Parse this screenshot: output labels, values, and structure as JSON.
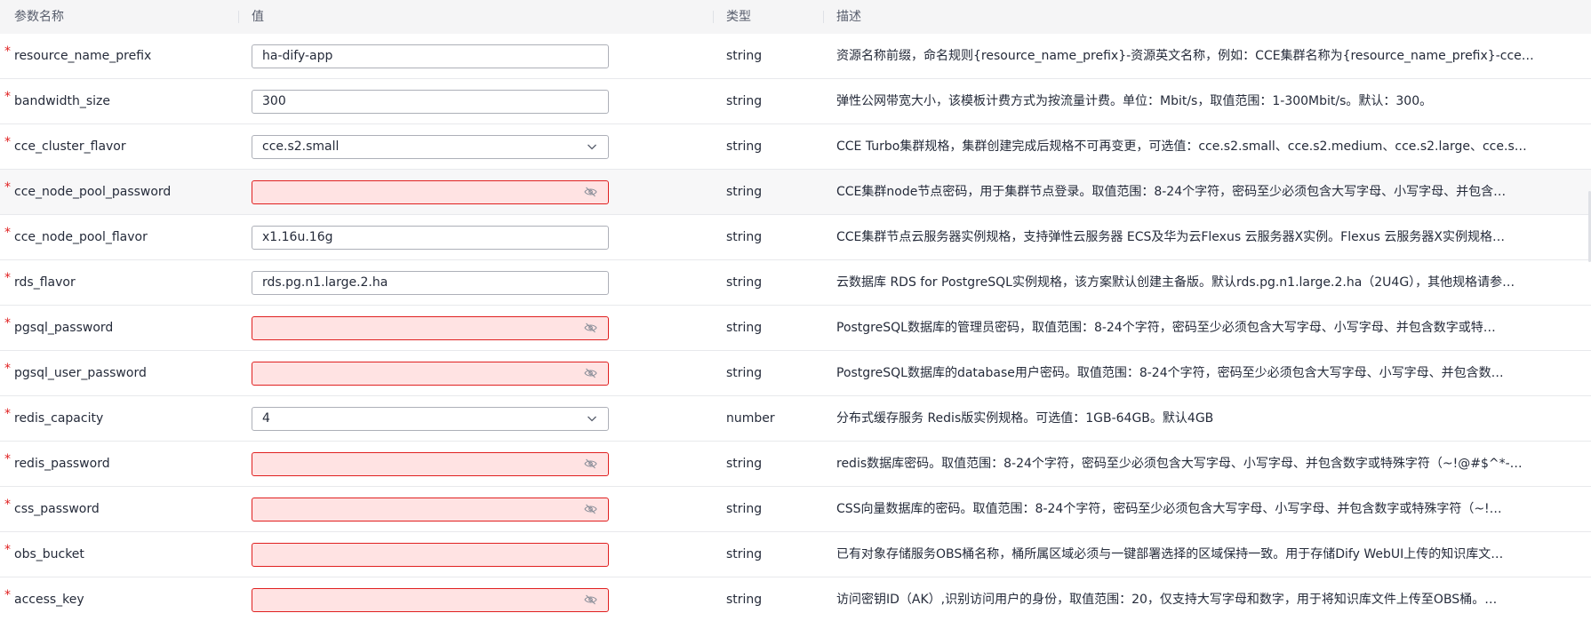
{
  "header": {
    "col_name": "参数名称",
    "col_value": "值",
    "col_type": "类型",
    "col_desc": "描述"
  },
  "rows": [
    {
      "required": "*",
      "name": "resource_name_prefix",
      "kind": "text",
      "value": "ha-dify-app",
      "type": "string",
      "desc": "资源名称前缀，命名规则{resource_name_prefix}-资源英文名称，例如：CCE集群名称为{resource_name_prefix}-cce…"
    },
    {
      "required": "*",
      "name": "bandwidth_size",
      "kind": "text",
      "value": "300",
      "type": "string",
      "desc": "弹性公网带宽大小，该模板计费方式为按流量计费。单位：Mbit/s，取值范围：1-300Mbit/s。默认：300。"
    },
    {
      "required": "*",
      "name": "cce_cluster_flavor",
      "kind": "select",
      "value": "cce.s2.small",
      "type": "string",
      "desc": "CCE Turbo集群规格，集群创建完成后规格不可再变更，可选值：cce.s2.small、cce.s2.medium、cce.s2.large、cce.s…"
    },
    {
      "required": "*",
      "name": "cce_node_pool_password",
      "kind": "password",
      "value": "",
      "type": "string",
      "desc": "CCE集群node节点密码，用于集群节点登录。取值范围：8-24个字符，密码至少必须包含大写字母、小写字母、并包含…"
    },
    {
      "required": "*",
      "name": "cce_node_pool_flavor",
      "kind": "text",
      "value": "x1.16u.16g",
      "type": "string",
      "desc": "CCE集群节点云服务器实例规格，支持弹性云服务器 ECS及华为云Flexus 云服务器X实例。Flexus 云服务器X实例规格…"
    },
    {
      "required": "*",
      "name": "rds_flavor",
      "kind": "text",
      "value": "rds.pg.n1.large.2.ha",
      "type": "string",
      "desc": "云数据库 RDS for PostgreSQL实例规格，该方案默认创建主备版。默认rds.pg.n1.large.2.ha（2U4G），其他规格请参…"
    },
    {
      "required": "*",
      "name": "pgsql_password",
      "kind": "password",
      "value": "",
      "type": "string",
      "desc": "PostgreSQL数据库的管理员密码，取值范围：8-24个字符，密码至少必须包含大写字母、小写字母、并包含数字或特…"
    },
    {
      "required": "*",
      "name": "pgsql_user_password",
      "kind": "password",
      "value": "",
      "type": "string",
      "desc": "PostgreSQL数据库的database用户密码。取值范围：8-24个字符，密码至少必须包含大写字母、小写字母、并包含数…"
    },
    {
      "required": "*",
      "name": "redis_capacity",
      "kind": "select",
      "value": "4",
      "type": "number",
      "desc": "分布式缓存服务 Redis版实例规格。可选值：1GB-64GB。默认4GB"
    },
    {
      "required": "*",
      "name": "redis_password",
      "kind": "password",
      "value": "",
      "type": "string",
      "desc": "redis数据库密码。取值范围：8-24个字符，密码至少必须包含大写字母、小写字母、并包含数字或特殊字符（~!@#$^*-…"
    },
    {
      "required": "*",
      "name": "css_password",
      "kind": "password",
      "value": "",
      "type": "string",
      "desc": "CSS向量数据库的密码。取值范围：8-24个字符，密码至少必须包含大写字母、小写字母、并包含数字或特殊字符（~!…"
    },
    {
      "required": "*",
      "name": "obs_bucket",
      "kind": "error",
      "value": "",
      "type": "string",
      "desc": "已有对象存储服务OBS桶名称，桶所属区域必须与一键部署选择的区域保持一致。用于存储Dify WebUI上传的知识库文…"
    },
    {
      "required": "*",
      "name": "access_key",
      "kind": "password",
      "value": "",
      "type": "string",
      "desc": "访问密钥ID（AK）,识别访问用户的身份，取值范围：20，仅支持大写字母和数字，用于将知识库文件上传至OBS桶。…"
    }
  ],
  "colors": {
    "required": "#e02020",
    "error_border": "#e02020",
    "error_fill": "#ffe3e3",
    "header_bg": "#f5f5f6"
  }
}
